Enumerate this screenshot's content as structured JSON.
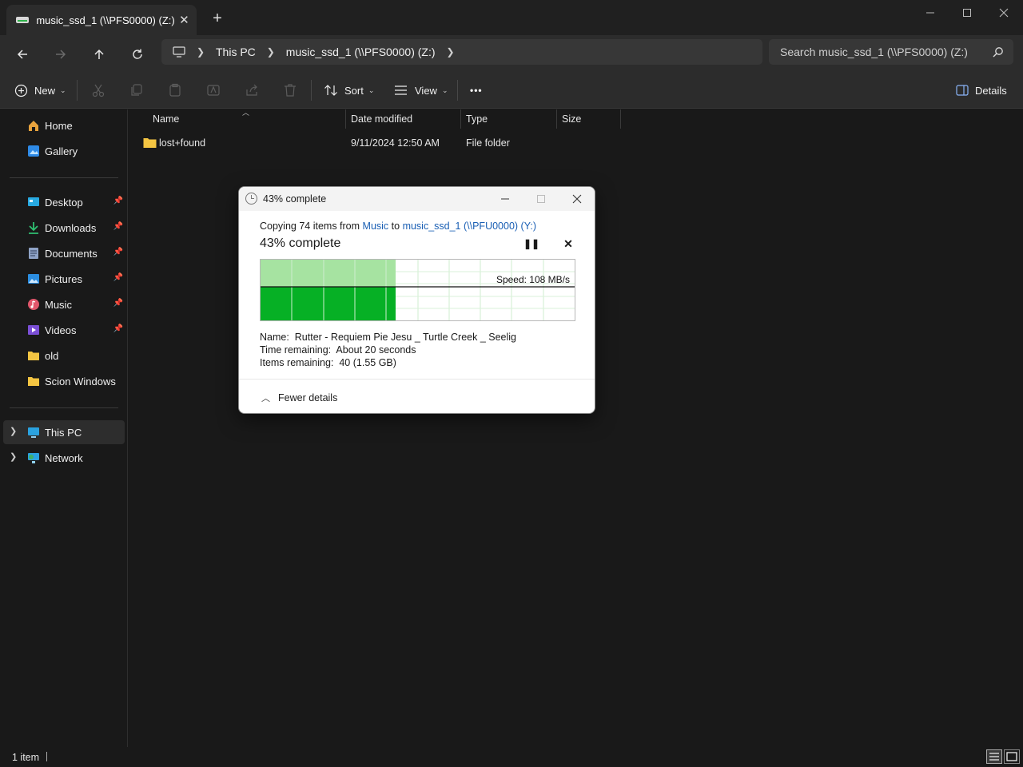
{
  "window": {
    "tab_title": "music_ssd_1 (\\\\PFS0000) (Z:)",
    "new_tab_label": "+"
  },
  "address": {
    "crumbs": [
      "This PC",
      "music_ssd_1 (\\\\PFS0000) (Z:)"
    ]
  },
  "search": {
    "placeholder": "Search music_ssd_1 (\\\\PFS0000) (Z:)"
  },
  "toolbar": {
    "new_label": "New",
    "sort_label": "Sort",
    "view_label": "View",
    "more_label": "•••",
    "details_label": "Details"
  },
  "sidebar": {
    "quick": [
      {
        "label": "Home",
        "icon": "home-icon"
      },
      {
        "label": "Gallery",
        "icon": "gallery-icon"
      }
    ],
    "pinned": [
      {
        "label": "Desktop",
        "icon": "desktop-icon",
        "pinned": true
      },
      {
        "label": "Downloads",
        "icon": "downloads-icon",
        "pinned": true
      },
      {
        "label": "Documents",
        "icon": "documents-icon",
        "pinned": true
      },
      {
        "label": "Pictures",
        "icon": "pictures-icon",
        "pinned": true
      },
      {
        "label": "Music",
        "icon": "music-icon",
        "pinned": true
      },
      {
        "label": "Videos",
        "icon": "videos-icon",
        "pinned": true
      },
      {
        "label": "old",
        "icon": "folder-icon",
        "pinned": false
      },
      {
        "label": "Scion Windows",
        "icon": "folder-icon",
        "pinned": false
      }
    ],
    "drives": [
      {
        "label": "This PC",
        "icon": "this-pc-icon",
        "selected": true
      },
      {
        "label": "Network",
        "icon": "network-icon",
        "selected": false
      }
    ]
  },
  "file_list": {
    "columns": [
      "Name",
      "Date modified",
      "Type",
      "Size"
    ],
    "rows": [
      {
        "name": "lost+found",
        "date": "9/11/2024 12:50 AM",
        "type": "File folder",
        "size": ""
      }
    ]
  },
  "status": {
    "item_count": "1 item"
  },
  "dialog": {
    "title": "43% complete",
    "copy_prefix": "Copying 74 items from ",
    "source": "Music",
    "to_word": " to ",
    "destination": "music_ssd_1 (\\\\PFU0000) (Y:)",
    "percent_text": "43% complete",
    "progress": 0.43,
    "speed": "Speed: 108 MB/s",
    "name_label": "Name:",
    "name_value": "Rutter - Requiem Pie Jesu _ Turtle Creek _ Seelig",
    "time_label": "Time remaining:",
    "time_value": "About 20 seconds",
    "items_label": "Items remaining:",
    "items_value": "40 (1.55 GB)",
    "fewer_details": "Fewer details"
  },
  "colors": {
    "progress_light": "#a6e3a1",
    "progress_dark": "#06b025",
    "link": "#1a5fb4"
  }
}
